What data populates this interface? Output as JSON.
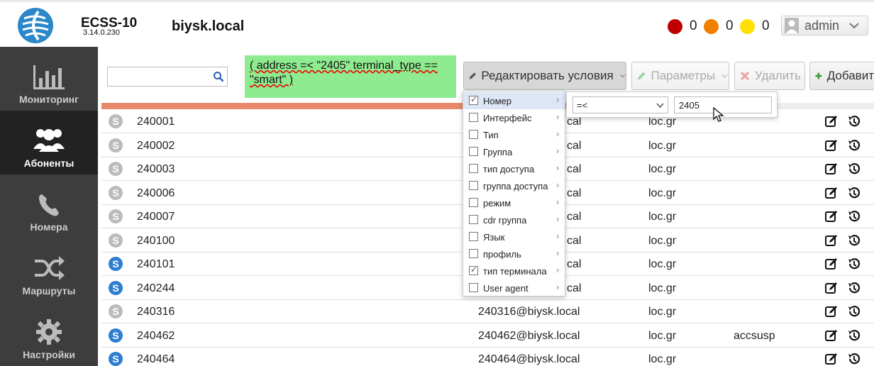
{
  "header": {
    "brand": "ECSS-10",
    "version": "3.14.0.230",
    "domain": "biysk.local",
    "alarms": [
      {
        "color": "#c00000",
        "count": "0"
      },
      {
        "color": "#f08000",
        "count": "0"
      },
      {
        "color": "#ffe000",
        "count": "0"
      }
    ],
    "user": "admin"
  },
  "sidebar": {
    "items": [
      {
        "label": "Мониторинг",
        "icon": "bar-chart-icon",
        "active": false
      },
      {
        "label": "Абоненты",
        "icon": "users-icon",
        "active": true
      },
      {
        "label": "Номера",
        "icon": "phone-icon",
        "active": false
      },
      {
        "label": "Маршруты",
        "icon": "shuffle-icon",
        "active": false
      },
      {
        "label": "Настройки",
        "icon": "gear-icon",
        "active": false
      }
    ]
  },
  "toolbar": {
    "search_value": "",
    "filter_expression": "( address =< \"2405\" terminal_type == \"smart\" )",
    "edit_conditions": "Редактировать условия",
    "parameters": "Параметры",
    "delete": "Удалить",
    "add": "Добавит"
  },
  "menu": {
    "items": [
      {
        "label": "Номер",
        "checked": true,
        "highlighted": true
      },
      {
        "label": "Интерфейс",
        "checked": false
      },
      {
        "label": "Тип",
        "checked": false
      },
      {
        "label": "Группа",
        "checked": false
      },
      {
        "label": "тип доступа",
        "checked": false
      },
      {
        "label": "группа доступа",
        "checked": false
      },
      {
        "label": "режим",
        "checked": false
      },
      {
        "label": "cdr группа",
        "checked": false
      },
      {
        "label": "Язык",
        "checked": false
      },
      {
        "label": "профиль",
        "checked": false
      },
      {
        "label": "тип терминала",
        "checked": true
      },
      {
        "label": "User agent",
        "checked": false
      }
    ],
    "operator": "=<",
    "value": "2405"
  },
  "table": {
    "rows": [
      {
        "badge": "grey",
        "number": "240001",
        "address": "",
        "addr_tail": "cal",
        "domain": "loc.gr",
        "profile": ""
      },
      {
        "badge": "grey",
        "number": "240002",
        "address": "",
        "addr_tail": "cal",
        "domain": "loc.gr",
        "profile": ""
      },
      {
        "badge": "grey",
        "number": "240003",
        "address": "",
        "addr_tail": "cal",
        "domain": "loc.gr",
        "profile": ""
      },
      {
        "badge": "grey",
        "number": "240006",
        "address": "",
        "addr_tail": "cal",
        "domain": "loc.gr",
        "profile": ""
      },
      {
        "badge": "grey",
        "number": "240007",
        "address": "",
        "addr_tail": "cal",
        "domain": "loc.gr",
        "profile": ""
      },
      {
        "badge": "grey",
        "number": "240100",
        "address": "",
        "addr_tail": "cal",
        "domain": "loc.gr",
        "profile": ""
      },
      {
        "badge": "blue",
        "number": "240101",
        "address": "",
        "addr_tail": "cal",
        "domain": "loc.gr",
        "profile": ""
      },
      {
        "badge": "blue",
        "number": "240244",
        "address": "",
        "addr_tail": "cal",
        "domain": "loc.gr",
        "profile": ""
      },
      {
        "badge": "grey",
        "number": "240316",
        "address": "240316@biysk.local",
        "addr_tail": "",
        "domain": "loc.gr",
        "profile": ""
      },
      {
        "badge": "blue",
        "number": "240462",
        "address": "240462@biysk.local",
        "addr_tail": "",
        "domain": "loc.gr",
        "profile": "accsusp"
      },
      {
        "badge": "blue",
        "number": "240464",
        "address": "240464@biysk.local",
        "addr_tail": "",
        "domain": "loc.gr",
        "profile": ""
      }
    ]
  },
  "colors": {
    "sidebar_bg": "#3d3d3d",
    "sidebar_active": "#222222",
    "filter_bg": "#8feb8f",
    "progress": "#e8896b",
    "badge_blue": "#2f7fd0",
    "badge_grey": "#bbbbbb"
  }
}
